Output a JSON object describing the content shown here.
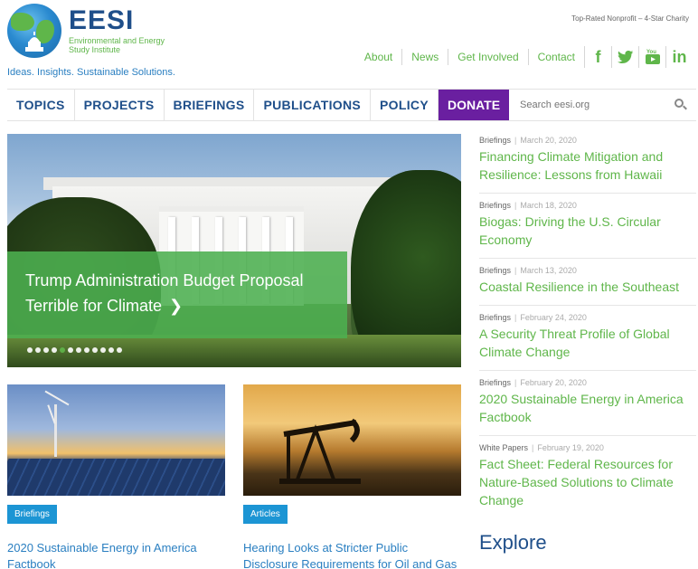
{
  "header": {
    "logo_text": "EESI",
    "logo_subtitle": "Environmental and Energy Study Institute",
    "tagline": "Ideas. Insights. Sustainable Solutions.",
    "top_rated": "Top-Rated Nonprofit – 4-Star Charity",
    "util_links": [
      "About",
      "News",
      "Get Involved",
      "Contact"
    ],
    "social": [
      {
        "icon": "facebook-icon",
        "glyph": "f"
      },
      {
        "icon": "twitter-icon",
        "glyph": "🐦"
      },
      {
        "icon": "youtube-icon",
        "glyph": "▶"
      },
      {
        "icon": "linkedin-icon",
        "glyph": "in"
      }
    ]
  },
  "nav": {
    "items": [
      "TOPICS",
      "PROJECTS",
      "BRIEFINGS",
      "PUBLICATIONS",
      "POLICY"
    ],
    "donate": "DONATE",
    "search_placeholder": "Search eesi.org"
  },
  "hero": {
    "title_line1": "Trump Administration Budget Proposal",
    "title_line2": "Terrible for Climate",
    "chevron": "❯",
    "slide_count": 12,
    "active_slide": 4
  },
  "cards": [
    {
      "badge": "Briefings",
      "title": "2020 Sustainable Energy in America Factbook"
    },
    {
      "badge": "Articles",
      "title": "Hearing Looks at Stricter Public Disclosure Requirements for Oil and Gas"
    }
  ],
  "sidebar": {
    "items": [
      {
        "category": "Briefings",
        "date": "March 20, 2020",
        "title": "Financing Climate Mitigation and Resilience: Lessons from Hawaii"
      },
      {
        "category": "Briefings",
        "date": "March 18, 2020",
        "title": "Biogas: Driving the U.S. Circular Economy"
      },
      {
        "category": "Briefings",
        "date": "March 13, 2020",
        "title": "Coastal Resilience in the Southeast"
      },
      {
        "category": "Briefings",
        "date": "February 24, 2020",
        "title": "A Security Threat Profile of Global Climate Change"
      },
      {
        "category": "Briefings",
        "date": "February 20, 2020",
        "title": "2020 Sustainable Energy in America Factbook"
      },
      {
        "category": "White Papers",
        "date": "February 19, 2020",
        "title": "Fact Sheet: Federal Resources for Nature-Based Solutions to Climate Change"
      }
    ],
    "explore": "Explore"
  },
  "colors": {
    "brand_blue": "#1f4f8a",
    "brand_green": "#5fb64a",
    "donate_purple": "#6a1fa0",
    "badge_blue": "#1c95d4"
  }
}
